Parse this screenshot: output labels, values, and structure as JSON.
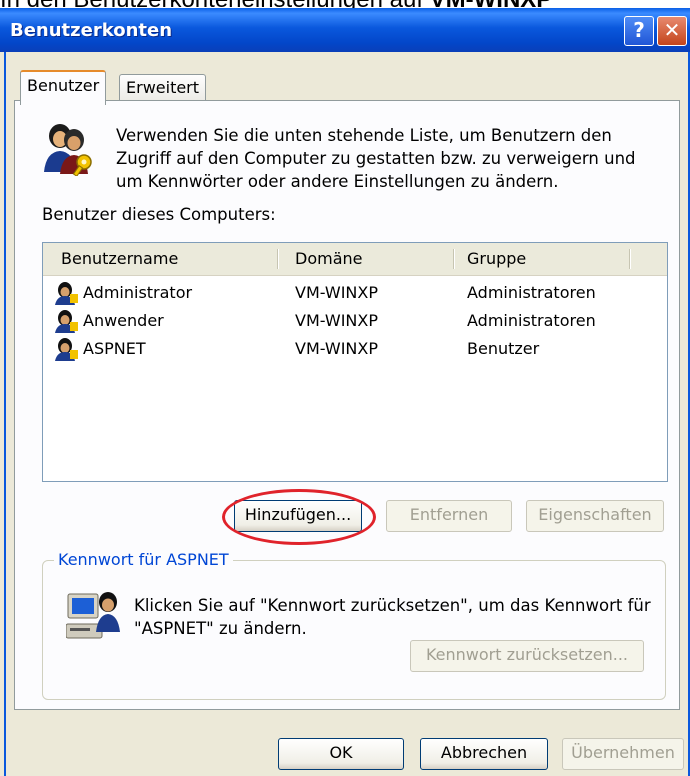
{
  "caption": {
    "prefix": "In den Benutzerkonteneinstellungen auf ",
    "bold": "VM-WINXP"
  },
  "window": {
    "title": "Benutzerkonten",
    "help_label": "?",
    "close_label": "✕"
  },
  "tabs": [
    {
      "label": "Benutzer",
      "active": true
    },
    {
      "label": "Erweitert",
      "active": false
    }
  ],
  "intro_text": "Verwenden Sie die unten stehende Liste, um Benutzern den Zugriff auf den Computer zu gestatten bzw. zu verweigern und um Kennwörter oder andere Einstellungen zu ändern.",
  "users_label": "Benutzer dieses Computers:",
  "table": {
    "columns": [
      "Benutzername",
      "Domäne",
      "Gruppe"
    ],
    "rows": [
      {
        "name": "Administrator",
        "domain": "VM-WINXP",
        "group": "Administratoren"
      },
      {
        "name": "Anwender",
        "domain": "VM-WINXP",
        "group": "Administratoren"
      },
      {
        "name": "ASPNET",
        "domain": "VM-WINXP",
        "group": "Benutzer"
      }
    ]
  },
  "buttons": {
    "add": "Hinzufügen...",
    "remove": "Entfernen",
    "properties": "Eigenschaften",
    "reset_password": "Kennwort zurücksetzen...",
    "ok": "OK",
    "cancel": "Abbrechen",
    "apply": "Übernehmen"
  },
  "password_group": {
    "legend": "Kennwort für ASPNET",
    "text": "Klicken Sie auf \"Kennwort zurücksetzen\", um das Kennwort für \"ASPNET\" zu ändern."
  },
  "colors": {
    "title_bar": "#0a58dd",
    "highlight": "#e0232b",
    "legend": "#0046d5"
  },
  "icons": {
    "users": "users-key-icon",
    "user": "user-icon",
    "computer": "computer-user-icon"
  }
}
